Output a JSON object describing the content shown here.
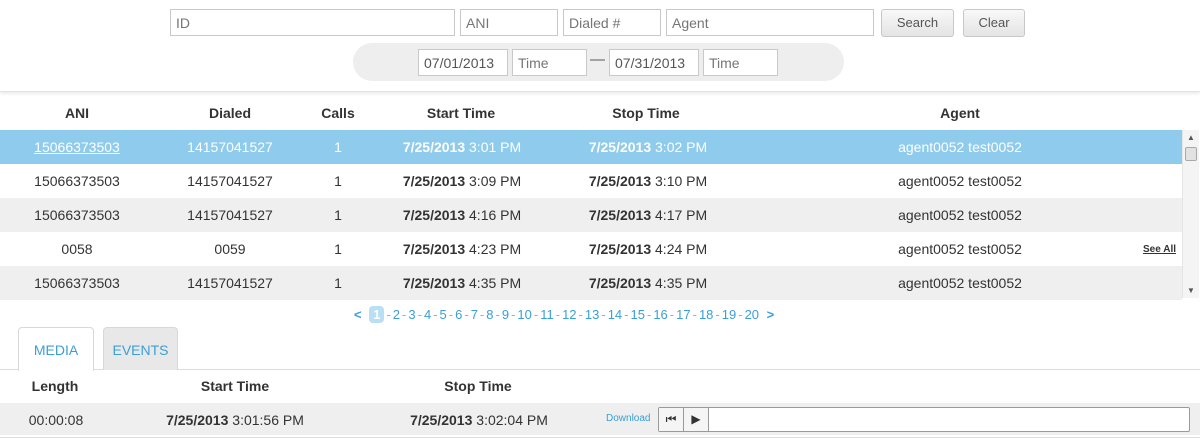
{
  "search": {
    "id_placeholder": "ID",
    "ani_placeholder": "ANI",
    "dialed_placeholder": "Dialed #",
    "agent_placeholder": "Agent",
    "search_label": "Search",
    "clear_label": "Clear",
    "start_date": "07/01/2013",
    "start_time_placeholder": "Time",
    "range_separator": "—",
    "end_date": "07/31/2013",
    "end_time_placeholder": "Time"
  },
  "table": {
    "headers": [
      "ANI",
      "Dialed",
      "Calls",
      "Start Time",
      "Stop Time",
      "Agent"
    ],
    "rows": [
      {
        "ani": "15066373503",
        "dialed": "14157041527",
        "calls": "1",
        "start_date": "7/25/2013",
        "start_time": "3:01 PM",
        "stop_date": "7/25/2013",
        "stop_time": "3:02 PM",
        "agent": "agent0052 test0052",
        "selected": true
      },
      {
        "ani": "15066373503",
        "dialed": "14157041527",
        "calls": "1",
        "start_date": "7/25/2013",
        "start_time": "3:09 PM",
        "stop_date": "7/25/2013",
        "stop_time": "3:10 PM",
        "agent": "agent0052 test0052"
      },
      {
        "ani": "15066373503",
        "dialed": "14157041527",
        "calls": "1",
        "start_date": "7/25/2013",
        "start_time": "4:16 PM",
        "stop_date": "7/25/2013",
        "stop_time": "4:17 PM",
        "agent": "agent0052 test0052"
      },
      {
        "ani": "0058",
        "dialed": "0059",
        "calls": "1",
        "start_date": "7/25/2013",
        "start_time": "4:23 PM",
        "stop_date": "7/25/2013",
        "stop_time": "4:24 PM",
        "agent": "agent0052 test0052",
        "see_all": "See All"
      },
      {
        "ani": "15066373503",
        "dialed": "14157041527",
        "calls": "1",
        "start_date": "7/25/2013",
        "start_time": "4:35 PM",
        "stop_date": "7/25/2013",
        "stop_time": "4:35 PM",
        "agent": "agent0052 test0052"
      }
    ]
  },
  "pagination": {
    "prev": "<",
    "next": ">",
    "current": "1",
    "pages": [
      "1",
      "2",
      "3",
      "4",
      "5",
      "6",
      "7",
      "8",
      "9",
      "10",
      "11",
      "12",
      "13",
      "14",
      "15",
      "16",
      "17",
      "18",
      "19",
      "20"
    ]
  },
  "tabs": [
    {
      "label": "MEDIA",
      "active": true
    },
    {
      "label": "EVENTS",
      "active": false
    }
  ],
  "media": {
    "headers": [
      "Length",
      "Start Time",
      "Stop Time"
    ],
    "row": {
      "length": "00:00:08",
      "start_date": "7/25/2013",
      "start_time": "3:01:56 PM",
      "stop_date": "7/25/2013",
      "stop_time": "3:02:04 PM",
      "download": "Download"
    }
  },
  "colors": {
    "accent": "#3a9fd6",
    "selected_row": "#8fcbec",
    "alt_row": "#efefef"
  }
}
